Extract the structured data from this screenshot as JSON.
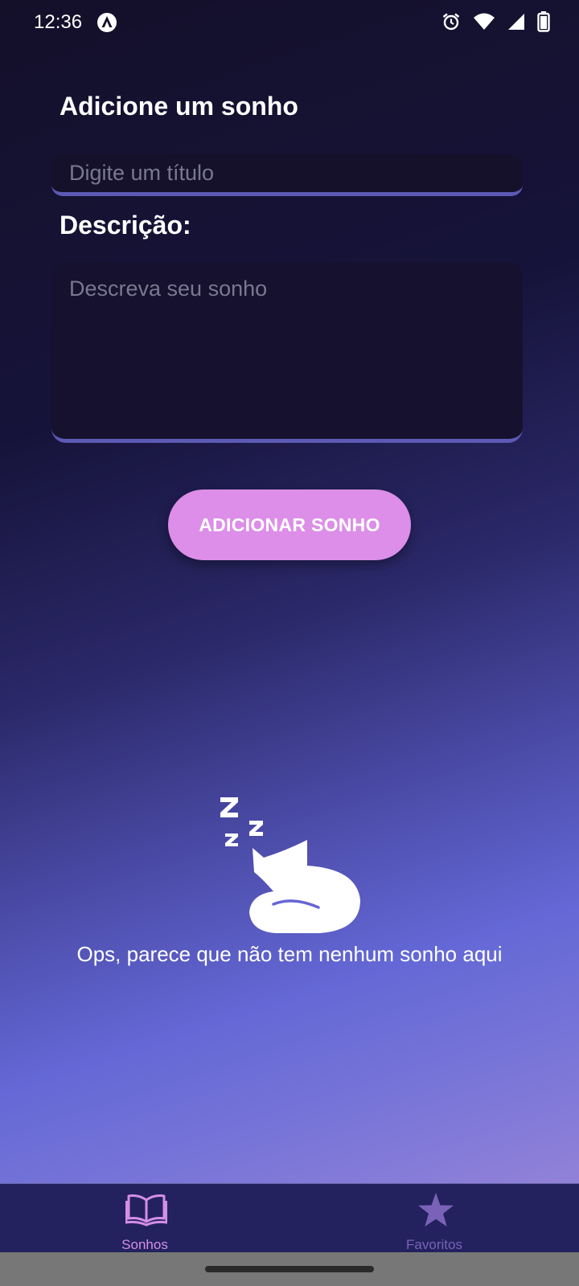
{
  "status_bar": {
    "time": "12:36",
    "app_icon": "app-logo-icon",
    "icons": [
      "alarm-icon",
      "wifi-icon",
      "signal-icon",
      "battery-icon"
    ]
  },
  "form": {
    "heading": "Adicione um sonho",
    "title_placeholder": "Digite um título",
    "title_value": "",
    "description_label": "Descrição:",
    "description_placeholder": "Descreva seu sonho",
    "description_value": "",
    "add_button_label": "ADICIONAR SONHO"
  },
  "empty_state": {
    "illustration": "sleeping-cat-icon",
    "message": "Ops, parece que não tem nenhum sonho aqui"
  },
  "bottom_nav": {
    "items": [
      {
        "label": "Sonhos",
        "icon": "book-icon",
        "active": true
      },
      {
        "label": "Favoritos",
        "icon": "star-icon",
        "active": false
      }
    ]
  },
  "colors": {
    "accent": "#dc8ee8",
    "input_underline": "#5c5ab4",
    "nav_background": "#23225e",
    "inactive_nav": "#7a62b8"
  }
}
